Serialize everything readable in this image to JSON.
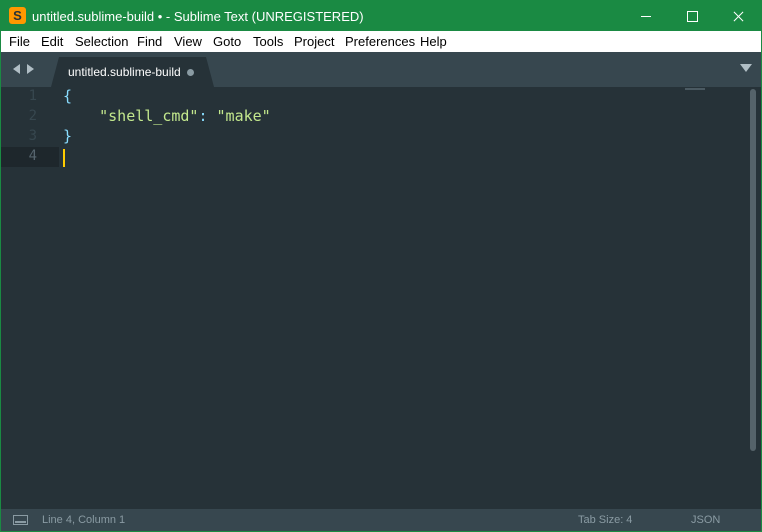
{
  "window": {
    "title": "untitled.sublime-build • - Sublime Text (UNREGISTERED)",
    "app_icon_letter": "S",
    "accent_color": "#1a8a43"
  },
  "menu": {
    "items": [
      "File",
      "Edit",
      "Selection",
      "Find",
      "View",
      "Goto",
      "Tools",
      "Project",
      "Preferences",
      "Help"
    ]
  },
  "tabs": [
    {
      "label": "untitled.sublime-build",
      "dirty": true,
      "active": true
    }
  ],
  "editor": {
    "line_numbers": [
      "1",
      "2",
      "3",
      "4"
    ],
    "current_line": 4,
    "lines": {
      "l1_brace": "{",
      "l2_indent": "    ",
      "l2_key": "\"shell_cmd\"",
      "l2_sep": ": ",
      "l2_value": "\"make\"",
      "l3_brace": "}"
    }
  },
  "status": {
    "position": "Line 4, Column 1",
    "tab_size": "Tab Size: 4",
    "syntax": "JSON"
  }
}
